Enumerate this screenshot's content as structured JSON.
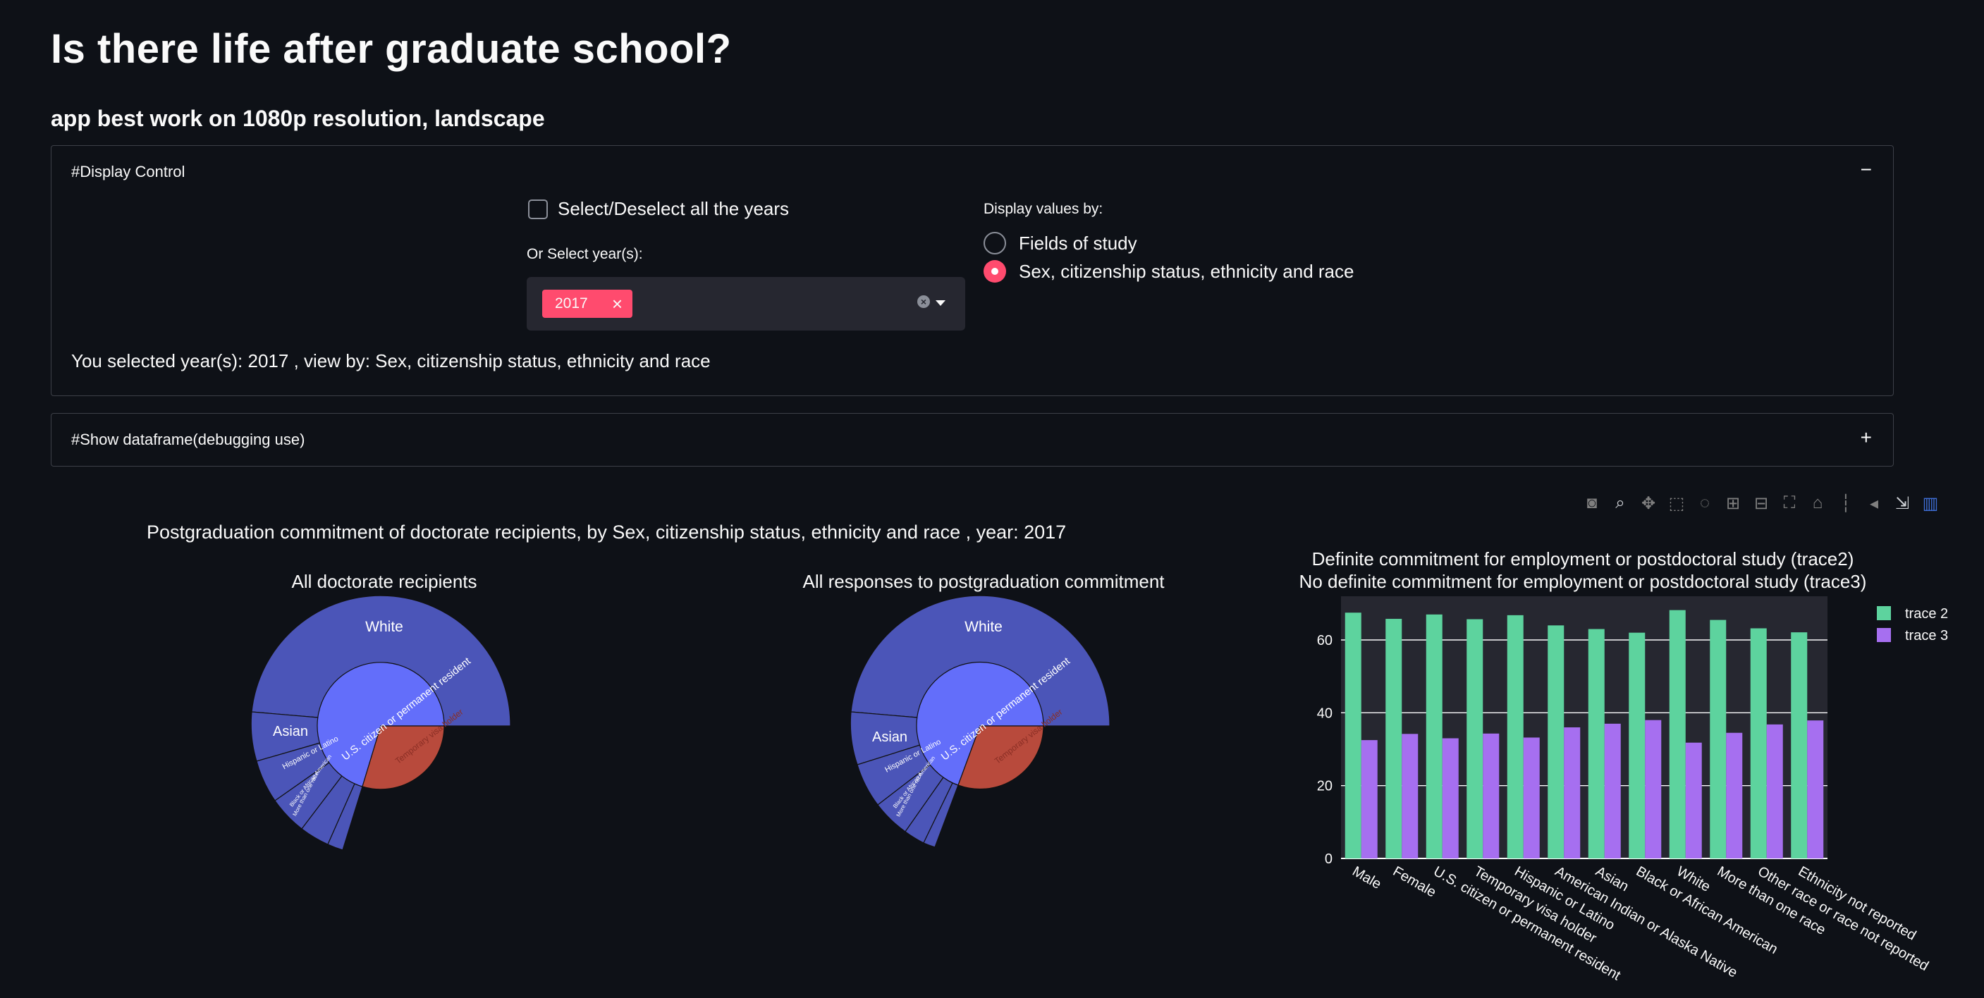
{
  "page": {
    "title": "Is there life after graduate school?",
    "subtitle": "app best work on 1080p resolution, landscape"
  },
  "display_control": {
    "header": "#Display Control",
    "toggle": "−",
    "select_all_label": "Select/Deselect all the years",
    "select_all_checked": false,
    "year_label": "Or Select year(s):",
    "selected_years": [
      "2017"
    ],
    "tag_close": "×",
    "radio_label": "Display values by:",
    "radio_options": [
      "Fields of study",
      "Sex, citizenship status, ethnicity and race"
    ],
    "radio_selected": "Sex, citizenship status, ethnicity and race",
    "selection_text": "You selected year(s): 2017 , view by: Sex, citizenship status, ethnicity and race"
  },
  "dataframe": {
    "header": "#Show dataframe(debugging use)",
    "toggle": "+"
  },
  "modebar": {
    "icons": [
      "camera-icon",
      "zoom-icon",
      "pan-icon",
      "box-select-icon",
      "lasso-icon",
      "zoom-in-icon",
      "zoom-out-icon",
      "autoscale-icon",
      "home-icon",
      "spike-lines-icon",
      "hover-icon",
      "compare-icon",
      "plotly-logo-icon"
    ]
  },
  "figure": {
    "title": "Postgraduation commitment of doctorate recipients, by Sex, citizenship status, ethnicity and race , year: 2017",
    "sunburst_left_title": "All doctorate recipients",
    "sunburst_right_title": "All responses to postgraduation commitment",
    "bar_title_line1": "Definite commitment for employment or postdoctoral study (trace2)",
    "bar_title_line2": "No definite commitment for employment or postdoctoral study (trace3)"
  },
  "sunburst_labels": {
    "outer": "White",
    "asian": "Asian",
    "inner_citizen": "U.S. citizen or permanent resident",
    "inner_visa": "Temporary visa holder",
    "hispanic": "Hispanic or Latino",
    "black": "Black or African American",
    "more": "More than one race"
  },
  "colors": {
    "background": "#0e1117",
    "accent": "#ff4b6e",
    "trace2": "#5dd39e",
    "trace3": "#a66ff0",
    "sunburst_inner": "#636efa",
    "sunburst_outer": "#4b55b8",
    "sunburst_visa": "#b84a3c",
    "plot_bg": "#262730"
  },
  "chart_data": {
    "type": "bar",
    "categories": [
      "Male",
      "Female",
      "U.S. citizen or permanent resident",
      "Temporary visa holder",
      "Hispanic or Latino",
      "American Indian or Alaska Native",
      "Asian",
      "Black or African American",
      "White",
      "More than one race",
      "Other race or race not reported",
      "Ethnicity not reported"
    ],
    "series": [
      {
        "name": "trace 2",
        "values": [
          67.5,
          65.8,
          67.0,
          65.7,
          66.8,
          64.0,
          63.0,
          62.0,
          68.2,
          65.5,
          63.2,
          62.1
        ]
      },
      {
        "name": "trace 3",
        "values": [
          32.5,
          34.2,
          33.0,
          34.3,
          33.2,
          36.0,
          37.0,
          38.0,
          31.8,
          34.5,
          36.8,
          37.9
        ]
      }
    ],
    "yticks": [
      0,
      20,
      40,
      60
    ],
    "ylim": [
      0,
      72
    ],
    "legend": [
      "trace 2",
      "trace 3"
    ],
    "legend_position": "top-right",
    "grid": true
  }
}
